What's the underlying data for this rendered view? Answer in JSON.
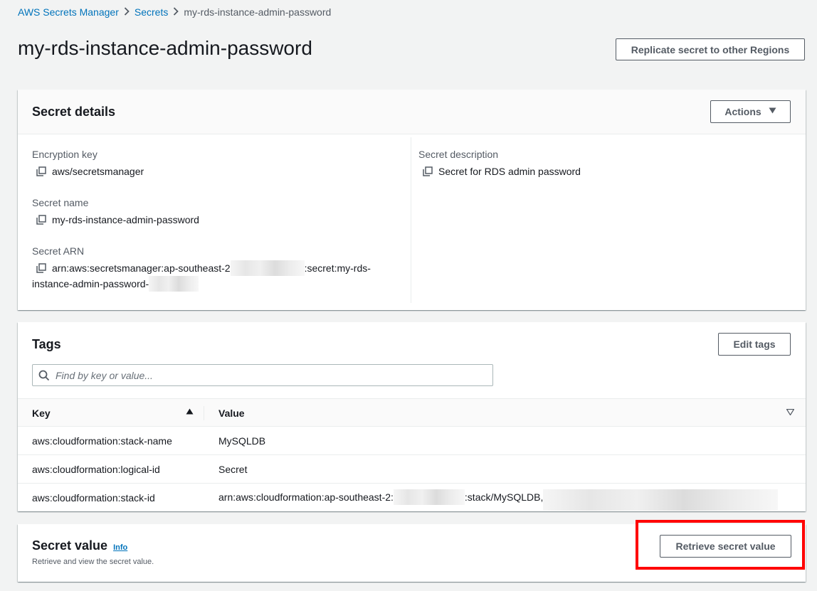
{
  "breadcrumb": {
    "items": [
      "AWS Secrets Manager",
      "Secrets"
    ],
    "current": "my-rds-instance-admin-password"
  },
  "page_title": "my-rds-instance-admin-password",
  "replicate_button": "Replicate secret to other Regions",
  "secret_details": {
    "title": "Secret details",
    "actions_button": "Actions",
    "encryption_key_label": "Encryption key",
    "encryption_key_value": "aws/secretsmanager",
    "secret_name_label": "Secret name",
    "secret_name_value": "my-rds-instance-admin-password",
    "secret_arn_label": "Secret ARN",
    "secret_arn_part1": "arn:aws:secretsmanager:ap-southeast-2",
    "secret_arn_part2": ":secret:my-rds-",
    "secret_arn_part3": "instance-admin-password-",
    "secret_description_label": "Secret description",
    "secret_description_value": "Secret for RDS admin password"
  },
  "tags": {
    "title": "Tags",
    "edit_button": "Edit tags",
    "search_placeholder": "Find by key or value...",
    "columns": [
      "Key",
      "Value"
    ],
    "rows": [
      {
        "key": "aws:cloudformation:stack-name",
        "value": "MySQLDB"
      },
      {
        "key": "aws:cloudformation:logical-id",
        "value": "Secret"
      },
      {
        "key": "aws:cloudformation:stack-id",
        "value_part1": "arn:aws:cloudformation:ap-southeast-2:",
        "value_part2": ":stack/MySQLDB,"
      }
    ]
  },
  "secret_value": {
    "title": "Secret value",
    "info": "Info",
    "subtitle": "Retrieve and view the secret value.",
    "retrieve_button": "Retrieve secret value"
  },
  "colors": {
    "link": "#0073bb",
    "highlight": "#ff0000",
    "background": "#f2f3f3"
  }
}
